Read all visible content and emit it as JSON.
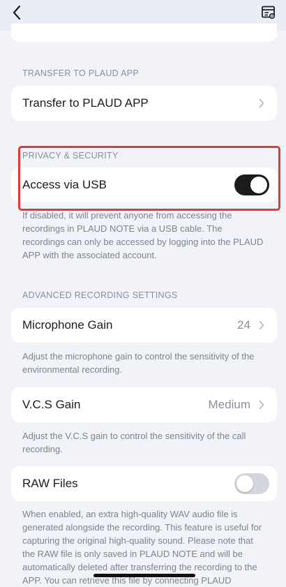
{
  "sections": {
    "transfer": {
      "header": "TRANSFER TO PLAUD APP",
      "row_label": "Transfer to PLAUD APP"
    },
    "privacy": {
      "header": "PRIVACY & SECURITY",
      "row_label": "Access via USB",
      "toggle_on": true,
      "description": "If disabled, it will prevent anyone from accessing the recordings in PLAUD NOTE via a USB cable. The recordings can only be accessed by logging into the PLAUD APP with the associated account."
    },
    "advanced": {
      "header": "ADVANCED RECORDING SETTINGS",
      "mic_label": "Microphone Gain",
      "mic_value": "24",
      "mic_description": "Adjust the microphone gain to control the sensitivity of the environmental recording.",
      "vcs_label": "V.C.S Gain",
      "vcs_value": "Medium",
      "vcs_description": "Adjust the V.C.S gain to control the sensitivity of the call recording.",
      "raw_label": "RAW Files",
      "raw_toggle_on": false,
      "raw_description": "When enabled, an extra high-quality WAV audio file is generated alongside the recording. This feature is useful for capturing the original high-quality sound. Please note that the RAW file is only saved in PLAUD NOTE and will be automatically deleted after transferring the recording to the APP. You can retrieve this file by connecting PLAUD"
    }
  },
  "icons": {
    "back": "chevron-left-icon",
    "top_action": "list-settings-icon",
    "row_chevron": "chevron-right-icon"
  },
  "colors": {
    "toggle_on": "#1c1c1e",
    "toggle_off": "#d3d6dc",
    "highlight": "#e5383b",
    "background": "#f1f3f8"
  }
}
